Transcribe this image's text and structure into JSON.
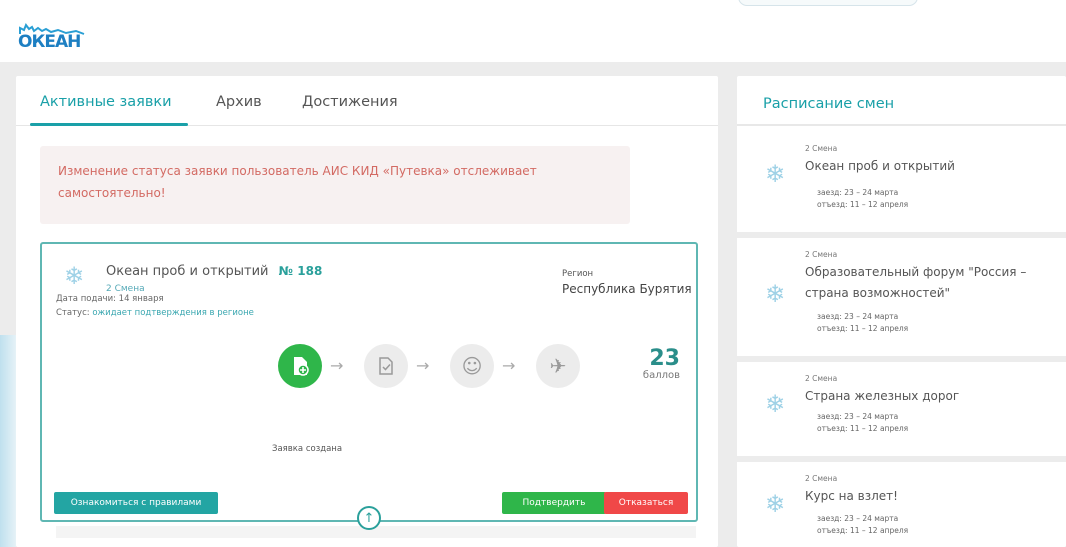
{
  "logo": {
    "text": "ОКЕАН"
  },
  "tabs": [
    {
      "label": "Активные заявки",
      "active": true
    },
    {
      "label": "Архив",
      "active": false
    },
    {
      "label": "Достижения",
      "active": false
    }
  ],
  "alert": {
    "line1": "Изменение статуса заявки пользователь АИС КИД «Путевка» отслеживает",
    "line2": "самостоятельно!"
  },
  "application": {
    "title": "Океан проб и открытий",
    "number": "№ 188",
    "shift": "2 Смена",
    "region_label": "Регион",
    "region": "Республика Бурятия",
    "date_line": "Дата подачи: 14 января",
    "status_label": "Статус:",
    "status_value": "ожидает подтверждения в регионе",
    "score": "23",
    "score_label": "баллов",
    "step_caption": "Заявка создана",
    "buttons": {
      "rules": "Ознакомиться с правилами",
      "confirm": "Подтвердить",
      "reject": "Отказаться"
    }
  },
  "schedule": {
    "title": "Расписание смен",
    "shifts": [
      {
        "label": "2 Смена",
        "name": "Океан проб и открытий",
        "arrival": "заезд: 23 – 24 марта",
        "departure": "отъезд: 11 – 12 апреля"
      },
      {
        "label": "2 Смена",
        "name": "Образовательный форум \"Россия – страна возможностей\"",
        "arrival": "заезд: 23 – 24 марта",
        "departure": "отъезд: 11 – 12 апреля"
      },
      {
        "label": "2 Смена",
        "name": "Страна железных дорог",
        "arrival": "заезд: 23 – 24 марта",
        "departure": "отъезд: 11 – 12 апреля"
      },
      {
        "label": "2 Смена",
        "name": "Курс на взлет!",
        "arrival": "заезд: 23 – 24 марта",
        "departure": "отъезд: 11 – 12 апреля"
      }
    ]
  },
  "colors": {
    "accent": "#1aa0a8",
    "success": "#2fb64a",
    "danger": "#f04848",
    "alert_text": "#d36a63"
  },
  "icons": {
    "shift": "snowflake-icon",
    "step1": "document-add-icon",
    "step2": "document-check-icon",
    "step3": "smile-icon",
    "step4": "airplane-icon",
    "scroll": "arrow-up-circle-icon"
  }
}
